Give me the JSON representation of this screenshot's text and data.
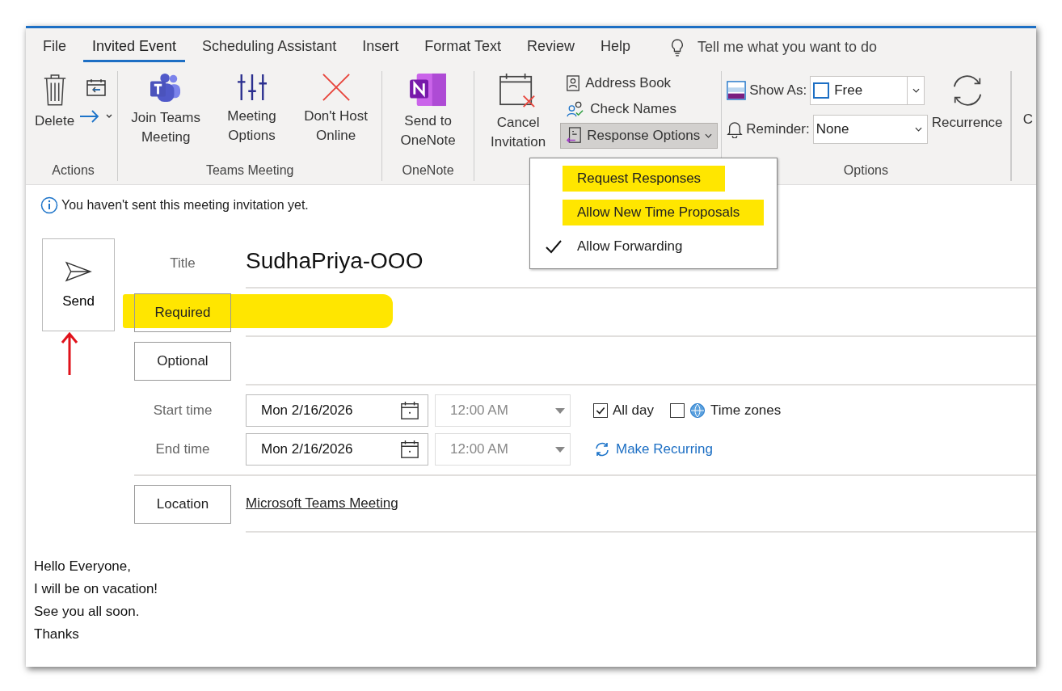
{
  "tabs": [
    {
      "label": "File",
      "selected": false
    },
    {
      "label": "Invited Event",
      "selected": true
    },
    {
      "label": "Scheduling Assistant",
      "selected": false
    },
    {
      "label": "Insert",
      "selected": false
    },
    {
      "label": "Format Text",
      "selected": false
    },
    {
      "label": "Review",
      "selected": false
    },
    {
      "label": "Help",
      "selected": false
    }
  ],
  "tell_me": "Tell me what you want to do",
  "ribbon": {
    "actions": {
      "label": "Actions",
      "delete": "Delete"
    },
    "teams": {
      "label": "Teams Meeting",
      "buttons": [
        "Join Teams Meeting",
        "Meeting Options",
        "Don't Host Online"
      ]
    },
    "onenote": {
      "label": "OneNote",
      "button": "Send to OneNote"
    },
    "attendees": {
      "cancel": "Cancel Invitation",
      "address_book": "Address Book",
      "check_names": "Check Names",
      "response_options": {
        "label": "Response Options",
        "expanded": true
      }
    },
    "options": {
      "label": "Options",
      "show_as_label": "Show As:",
      "show_as_value": "Free",
      "reminder_label": "Reminder:",
      "reminder_value": "None",
      "recurrence": "Recurrence"
    },
    "cut_text": "C"
  },
  "response_menu": [
    {
      "label": "Request Responses",
      "checked": false,
      "highlighted": true
    },
    {
      "label": "Allow New Time Proposals",
      "checked": false,
      "highlighted": true
    },
    {
      "label": "Allow Forwarding",
      "checked": true,
      "highlighted": false
    }
  ],
  "info": "You haven't sent this meeting invitation yet.",
  "send": "Send",
  "title": {
    "label": "Title",
    "value": "SudhaPriya-OOO"
  },
  "required": {
    "label": "Required",
    "highlighted": true
  },
  "optional": {
    "label": "Optional"
  },
  "start": {
    "label": "Start time",
    "date": "Mon 2/16/2026",
    "time": "12:00 AM"
  },
  "end": {
    "label": "End time",
    "date": "Mon 2/16/2026",
    "time": "12:00 AM"
  },
  "all_day": {
    "label": "All day",
    "checked": true
  },
  "time_zones": {
    "label": "Time zones",
    "checked": false
  },
  "make_recurring": "Make Recurring",
  "location": {
    "label": "Location",
    "value": "Microsoft Teams Meeting"
  },
  "body": [
    "Hello Everyone,",
    "I will be on vacation!",
    "See you all soon.",
    "Thanks"
  ]
}
